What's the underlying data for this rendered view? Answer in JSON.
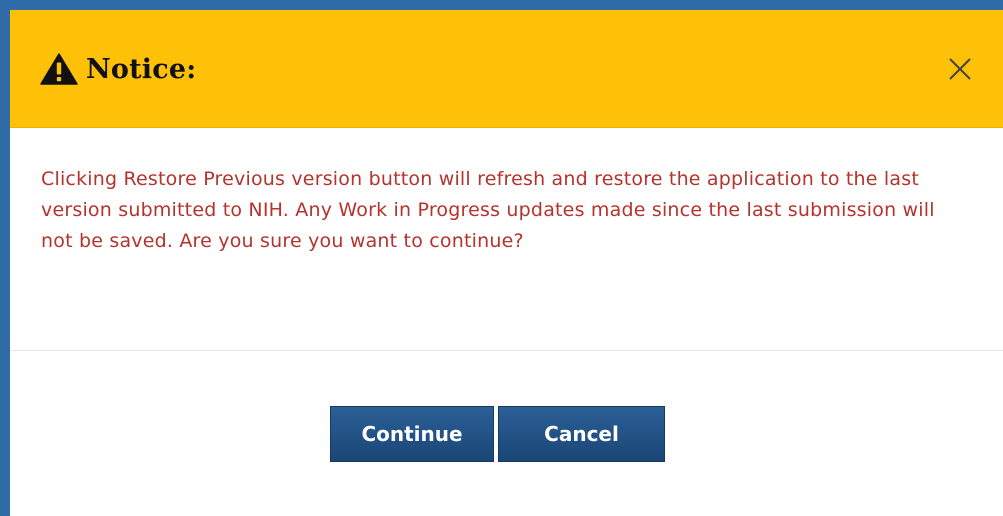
{
  "dialog": {
    "title": "Notice:",
    "title_icon": "warning-icon",
    "close_icon": "close-icon",
    "message": "Clicking Restore Previous version button will refresh and restore the application to the last version submitted to NIH. Any Work in Progress updates made since the last submission will not be saved. Are you sure you want to continue?",
    "buttons": {
      "continue_label": "Continue",
      "cancel_label": "Cancel"
    }
  },
  "colors": {
    "header_background": "#ffc107",
    "message_text": "#b5332c",
    "button_background": "#1f4f84",
    "page_background": "#2f6ca8"
  }
}
